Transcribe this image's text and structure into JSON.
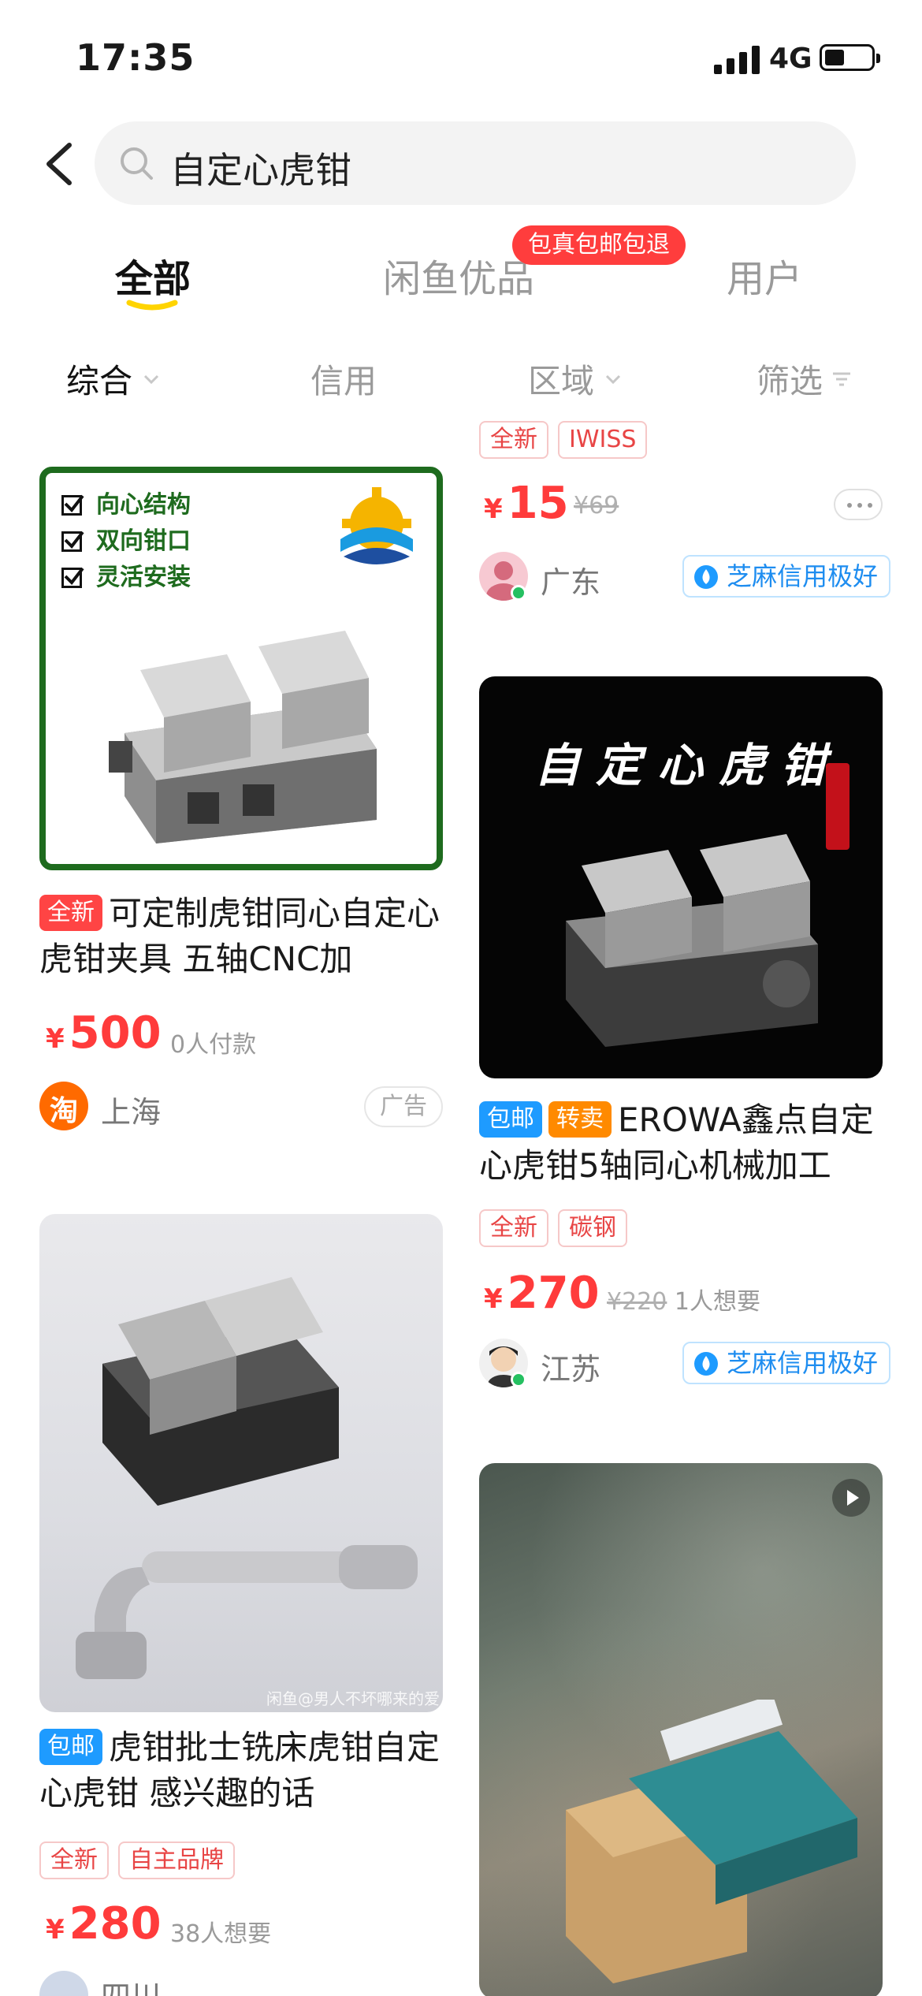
{
  "status_bar": {
    "time": "17:35",
    "network": "4G"
  },
  "search": {
    "query": "自定心虎钳"
  },
  "tabs": [
    {
      "label": "全部",
      "active": true
    },
    {
      "label": "闲鱼优品",
      "active": false
    },
    {
      "label": "用户",
      "active": false
    }
  ],
  "promo_badge": "包真包邮包退",
  "filters": [
    {
      "label": "综合",
      "active": true
    },
    {
      "label": "信用"
    },
    {
      "label": "区域"
    },
    {
      "label": "筛选"
    }
  ],
  "colors": {
    "accent_price": "#ff3b3b",
    "tab_underline": "#ffd400",
    "brand_blue": "#1e9bff"
  },
  "items": [
    {
      "id": "top-right",
      "tags": [
        "全新",
        "IWISS"
      ],
      "price_symbol": "¥",
      "price": "15",
      "original_price": "¥69",
      "location": "广东",
      "credit": "芝麻信用极好"
    },
    {
      "id": "left-1",
      "image_labels": [
        "向心结构",
        "双向钳口",
        "灵活安装"
      ],
      "badge": "全新",
      "title": "可定制虎钳同心自定心虎钳夹具 五轴CNC加",
      "price_symbol": "¥",
      "price": "500",
      "payers": "0人付款",
      "location": "上海",
      "ad_label": "广告",
      "shop_icon": "淘"
    },
    {
      "id": "right-1",
      "image_title": "自定心虎钳",
      "badges": [
        "包邮",
        "转卖"
      ],
      "title": "EROWA鑫点自定心虎钳5轴同心机械加工",
      "tags": [
        "全新",
        "碳钢"
      ],
      "price_symbol": "¥",
      "price": "270",
      "original_price": "¥220",
      "wants": "1人想要",
      "location": "江苏",
      "credit": "芝麻信用极好"
    },
    {
      "id": "left-2",
      "watermark": "闲鱼@男人不坏哪来的爱",
      "badge": "包邮",
      "title": "虎钳批士铣床虎钳自定心虎钳 感兴趣的话",
      "tags": [
        "全新",
        "自主品牌"
      ],
      "price_symbol": "¥",
      "price": "280",
      "wants": "38人想要",
      "location": "四川"
    },
    {
      "id": "right-2",
      "has_video": true
    }
  ]
}
